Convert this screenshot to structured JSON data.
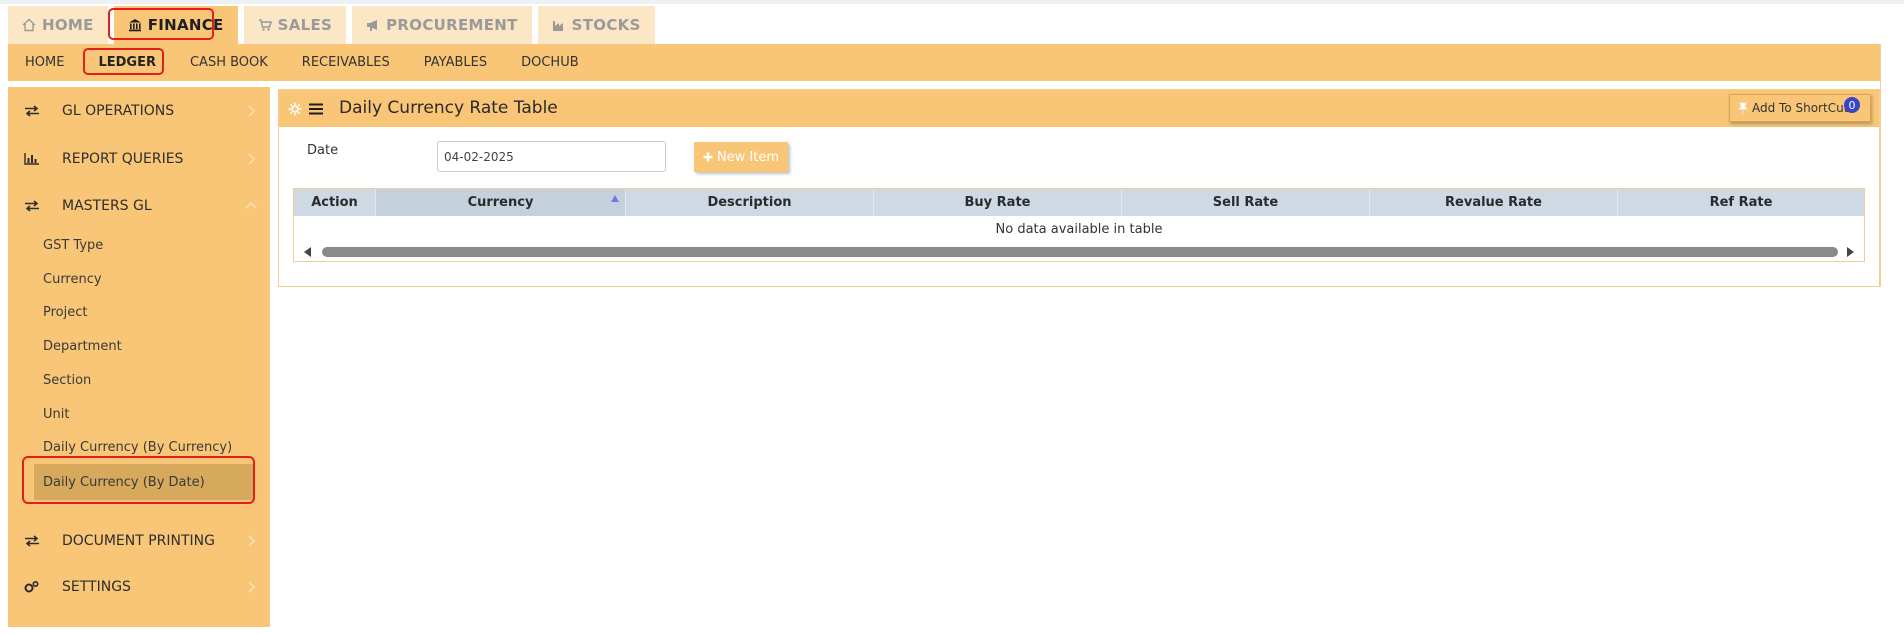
{
  "top_tabs": [
    {
      "label": "HOME",
      "icon": "home-icon",
      "active": false
    },
    {
      "label": "FINANCE",
      "icon": "bank-icon",
      "active": true
    },
    {
      "label": "SALES",
      "icon": "cart-icon",
      "active": false
    },
    {
      "label": "PROCUREMENT",
      "icon": "megaphone-icon",
      "active": false
    },
    {
      "label": "STOCKS",
      "icon": "factory-icon",
      "active": false
    }
  ],
  "sub_nav": [
    {
      "label": "HOME",
      "active": false
    },
    {
      "label": "LEDGER",
      "active": true
    },
    {
      "label": "CASH BOOK",
      "active": false
    },
    {
      "label": "RECEIVABLES",
      "active": false
    },
    {
      "label": "PAYABLES",
      "active": false
    },
    {
      "label": "DOCHUB",
      "active": false
    }
  ],
  "sidebar": {
    "groups": [
      {
        "label": "GL OPERATIONS",
        "icon": "exchange-icon",
        "expanded": false
      },
      {
        "label": "REPORT QUERIES",
        "icon": "bar-chart-icon",
        "expanded": false
      },
      {
        "label": "MASTERS GL",
        "icon": "exchange-icon",
        "expanded": true
      },
      {
        "label": "DOCUMENT PRINTING",
        "icon": "exchange-icon",
        "expanded": false
      },
      {
        "label": "SETTINGS",
        "icon": "cogs-icon",
        "expanded": false
      }
    ],
    "masters_items": [
      {
        "label": "GST Type"
      },
      {
        "label": "Currency"
      },
      {
        "label": "Project"
      },
      {
        "label": "Department"
      },
      {
        "label": "Section"
      },
      {
        "label": "Unit"
      },
      {
        "label": "Daily Currency (By Currency)"
      },
      {
        "label": "Daily Currency (By Date)",
        "active": true
      }
    ]
  },
  "panel": {
    "title": "Daily Currency Rate Table",
    "shortcut_label": "Add To ShortCut",
    "shortcut_count": "0"
  },
  "form": {
    "date_label": "Date",
    "date_value": "04-02-2025",
    "new_item_label": "New Item"
  },
  "table": {
    "columns": [
      "Action",
      "Currency",
      "Description",
      "Buy Rate",
      "Sell Rate",
      "Revalue Rate",
      "Ref Rate"
    ],
    "empty_message": "No data available in table"
  },
  "colors": {
    "accent": "#f8c676",
    "accent_light": "#fbe6c5",
    "active_row": "#d6a95c",
    "table_header": "#cfd9e3",
    "highlight": "#e0201c"
  }
}
